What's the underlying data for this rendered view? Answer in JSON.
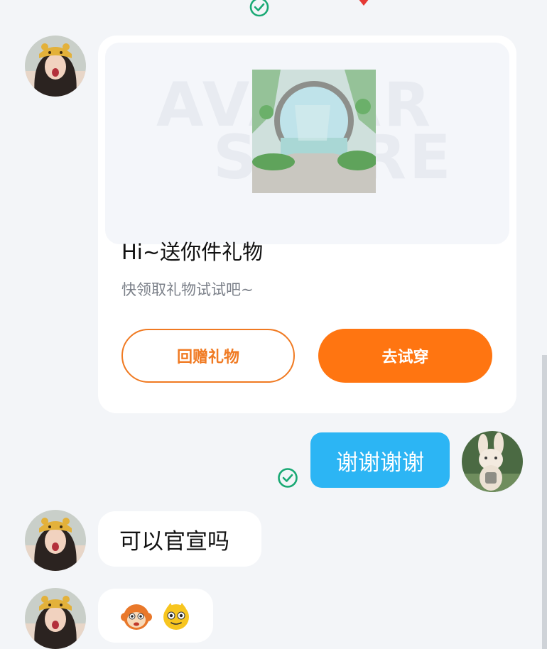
{
  "card": {
    "title": "Hi~送你件礼物",
    "subtitle": "快领取礼物试试吧~",
    "button_return": "回赠礼物",
    "button_try": "去试穿",
    "watermark_line1": "AVATAR",
    "watermark_line2": "STORE"
  },
  "messages": {
    "sent_text": "谢谢谢谢",
    "received_text": "可以官宣吗"
  },
  "colors": {
    "accent_orange": "#ff7511",
    "sent_bubble": "#2cb5f4",
    "check_green": "#19a974"
  },
  "icons": {
    "read_check": "check-circle-icon",
    "emoji_1": "monkey-emoji-icon",
    "emoji_2": "yellow-face-emoji-icon"
  }
}
